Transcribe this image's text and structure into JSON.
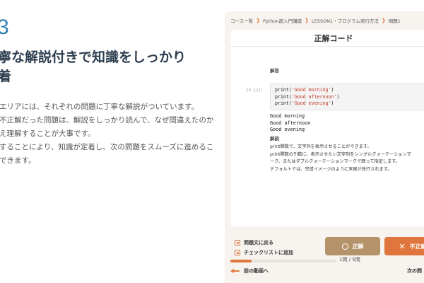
{
  "promo": {
    "step_number": "3",
    "headline": "寧な解説付きで知識をしっかり\n着",
    "body": "エリアには、それぞれの問題に丁寧な解説がついています。\n不正解だった問題は、解説をしっかり読んで、なぜ間違えたのか\nえ理解することが大事です。\nすることにより、知識が定着し、次の問題をスムーズに進めるこ\nできます。"
  },
  "breadcrumb": [
    "コース一覧",
    "Python超入門講座",
    "LESSON1・プログラム実行方法",
    "問題1"
  ],
  "card": {
    "title": "正解コード",
    "answer_label": "解答",
    "prompt": "In [1]:",
    "code_lines": [
      {
        "pre": "print(",
        "str": "'Good morning'",
        "post": ")"
      },
      {
        "pre": "print(",
        "str": "'Good afternoon'",
        "post": ")"
      },
      {
        "pre": "print(",
        "str": "'Good evening'",
        "post": ")"
      }
    ],
    "output_lines": [
      "Good morning",
      "Good afternoon",
      "Good evening"
    ],
    "explain_label": "解説",
    "explanation": "print関数で、文字列を表示させることができます。\nprint関数の引数に、表示させたい文字列をシングルクォーテーションマ\nーク、またはダブルクォーテーションマークで囲って指定します。\nデフォルトでは、完成イメージのように末尾が改行されます。"
  },
  "actions": {
    "back_to_question": "問題文に戻る",
    "add_checklist": "チェックリストに追加",
    "correct_label": "正解",
    "wrong_label": "不正解"
  },
  "progress": {
    "label": "1問 / 5問",
    "fraction": 0.2
  },
  "nav": {
    "prev_label": "前の動画へ",
    "next_label": "次の問"
  },
  "colors": {
    "accent": "#e0763e",
    "correct_button": "#b5936a",
    "step_number": "#2f7fb0",
    "panel_bg": "#f7f3ee"
  }
}
